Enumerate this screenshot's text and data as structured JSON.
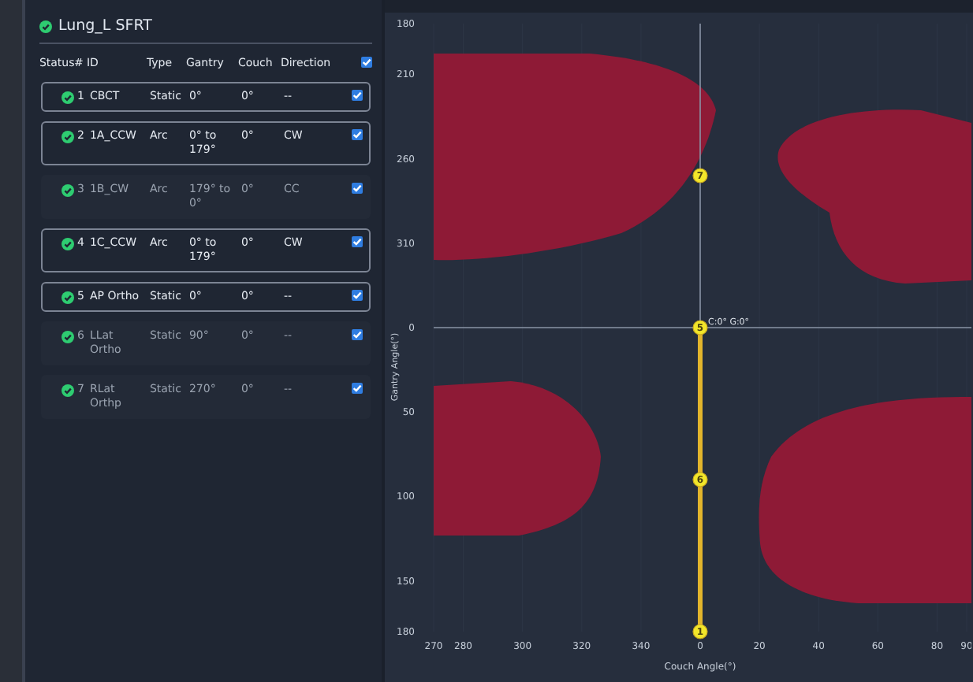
{
  "plan": {
    "title": "Lung_L SFRT",
    "ok": true
  },
  "table": {
    "columns": [
      "Status",
      "#",
      "ID",
      "Type",
      "Gantry",
      "Couch",
      "Direction"
    ],
    "all_checked": true,
    "rows": [
      {
        "ok": true,
        "number": "1",
        "id": "CBCT",
        "type": "Static",
        "gantry": "0°",
        "couch": "0°",
        "direction": "--",
        "checked": true,
        "selected": true
      },
      {
        "ok": true,
        "number": "2",
        "id": "1A_CCW",
        "type": "Arc",
        "gantry": "0° to 179°",
        "couch": "0°",
        "direction": "CW",
        "checked": true,
        "selected": true
      },
      {
        "ok": true,
        "number": "3",
        "id": "1B_CW",
        "type": "Arc",
        "gantry": "179° to 0°",
        "couch": "0°",
        "direction": "CC",
        "checked": true,
        "selected": false
      },
      {
        "ok": true,
        "number": "4",
        "id": "1C_CCW",
        "type": "Arc",
        "gantry": "0° to 179°",
        "couch": "0°",
        "direction": "CW",
        "checked": true,
        "selected": true
      },
      {
        "ok": true,
        "number": "5",
        "id": "AP Ortho",
        "type": "Static",
        "gantry": "0°",
        "couch": "0°",
        "direction": "--",
        "checked": true,
        "selected": true
      },
      {
        "ok": true,
        "number": "6",
        "id": "LLat Ortho",
        "type": "Static",
        "gantry": "90°",
        "couch": "0°",
        "direction": "--",
        "checked": true,
        "selected": false
      },
      {
        "ok": true,
        "number": "7",
        "id": "RLat Orthp",
        "type": "Static",
        "gantry": "270°",
        "couch": "0°",
        "direction": "--",
        "checked": true,
        "selected": false
      }
    ]
  },
  "collision_map": {
    "xlabel": "Couch Angle(°)",
    "ylabel": "Gantry Angle(°)",
    "xticks": [
      "270",
      "280",
      "300",
      "320",
      "340",
      "0",
      "20",
      "40",
      "60",
      "80",
      "90"
    ],
    "yticks": [
      "180",
      "210",
      "260",
      "310",
      "0",
      "50",
      "100",
      "150",
      "180"
    ],
    "markers": [
      {
        "label": "7"
      },
      {
        "label": "5"
      },
      {
        "label": "6"
      },
      {
        "label": "1"
      }
    ],
    "readout": "C:0° G:0°"
  }
}
